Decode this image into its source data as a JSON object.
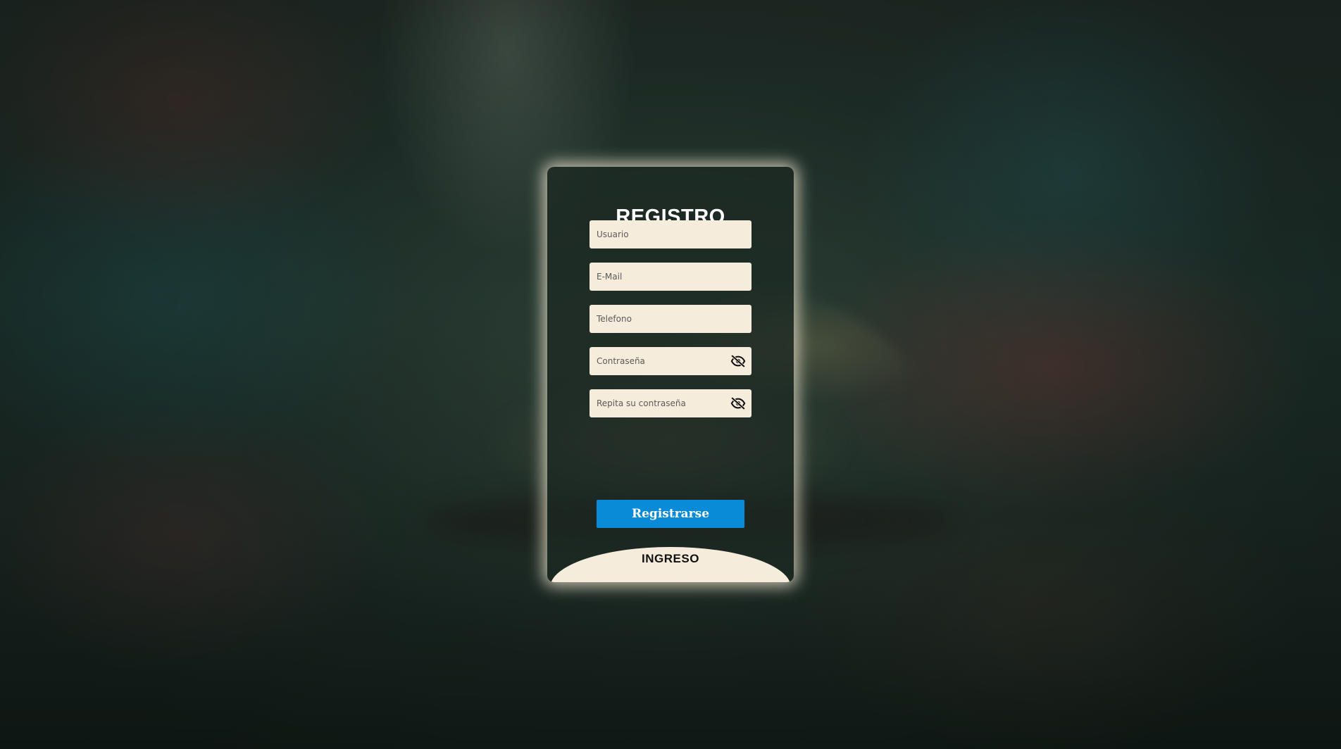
{
  "form": {
    "title": "REGISTRO",
    "fields": {
      "usuario": {
        "placeholder": "Usuario",
        "value": ""
      },
      "email": {
        "placeholder": "E-Mail",
        "value": ""
      },
      "telefono": {
        "placeholder": "Telefono",
        "value": ""
      },
      "password": {
        "placeholder": "Contraseña",
        "value": ""
      },
      "password_repeat": {
        "placeholder": "Repita su contraseña",
        "value": ""
      }
    },
    "submit_label": "Registrarse",
    "login_label": "INGRESO"
  },
  "icons": {
    "password_toggle": "eye-slash-icon"
  },
  "colors": {
    "field_background": "#f6ecdc",
    "button_accent": "#0a8bd8",
    "card_glow": "#f6ecd6",
    "title_text": "#ffffff"
  }
}
